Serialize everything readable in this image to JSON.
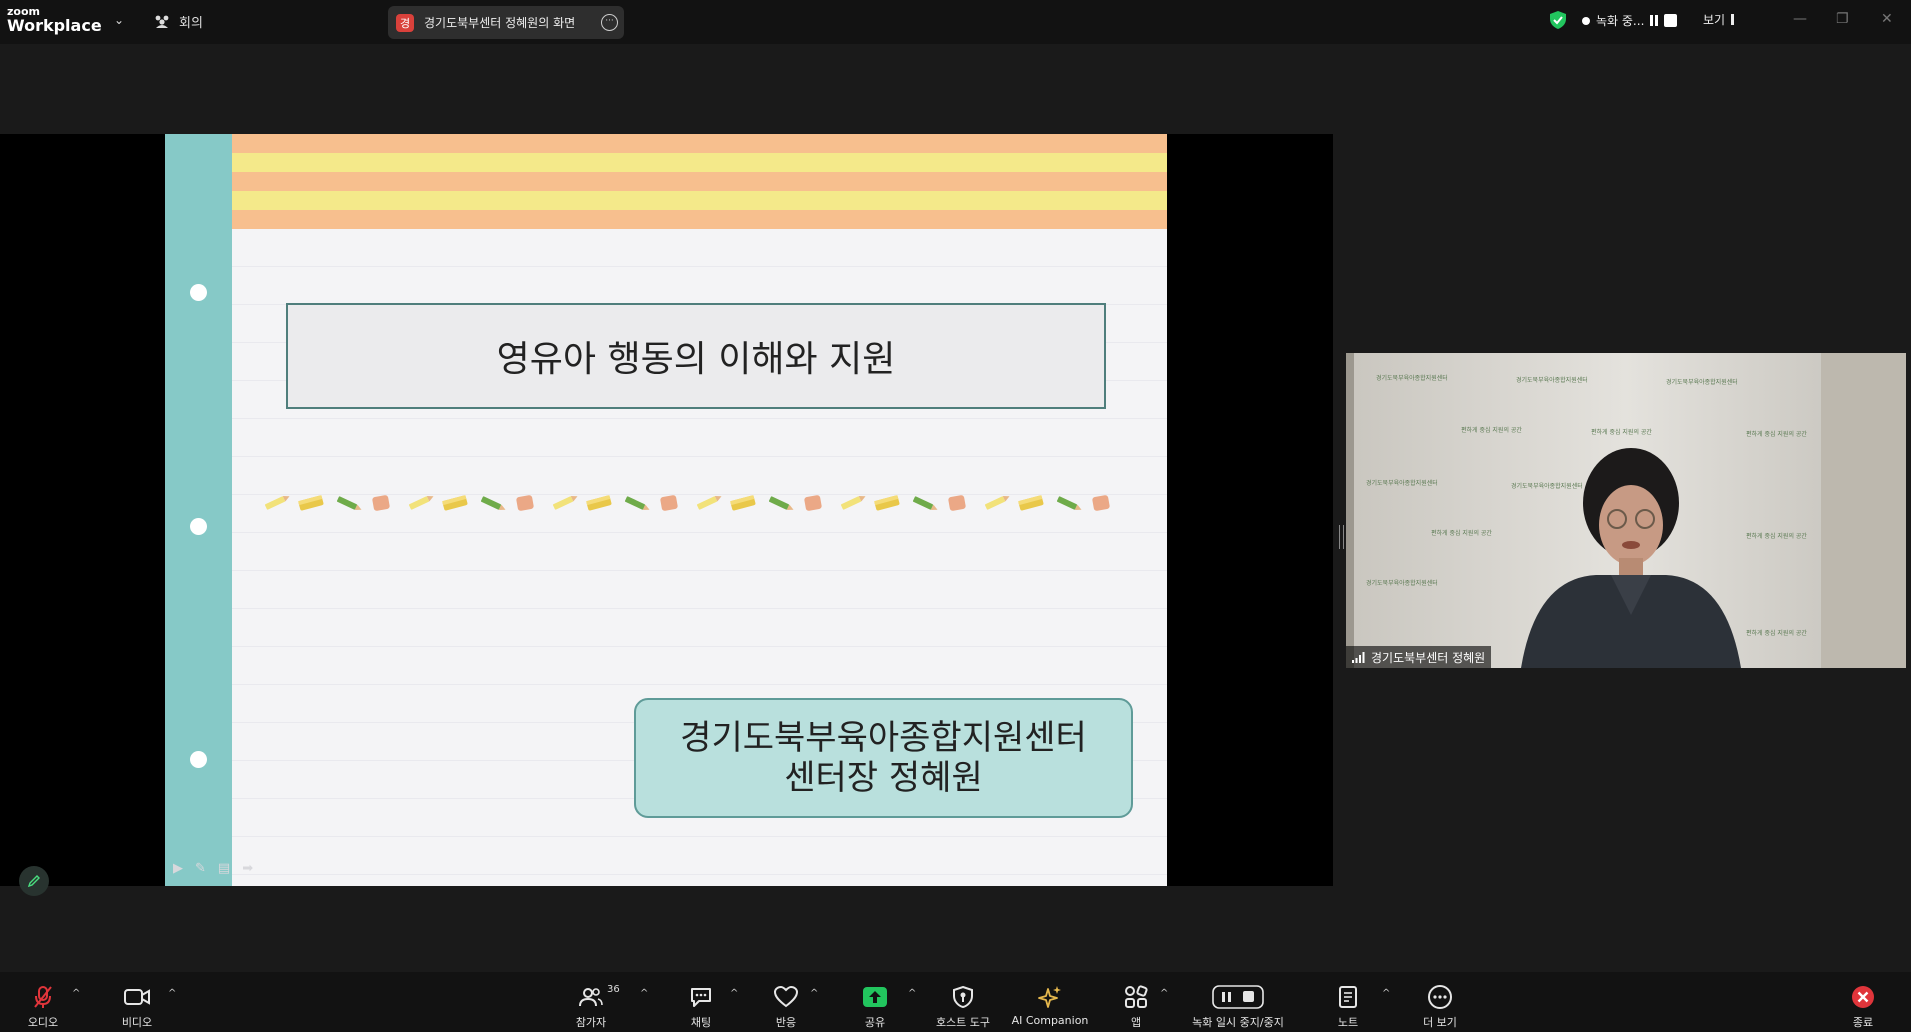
{
  "app": {
    "logo_line1": "zoom",
    "logo_line2": "Workplace"
  },
  "topbar": {
    "meeting_label": "회의",
    "share_badge": "경",
    "share_title": "경기도북부센터 정혜원의 화면",
    "recording_label": "녹화 중...",
    "view_label": "보기"
  },
  "slide": {
    "title": "영유아 행동의 이해와 지원",
    "org_line": "경기도북부육아종합지원센터",
    "presenter_line": "센터장 정혜원",
    "stripe_colors": [
      "#f7bf8e",
      "#f4e98a"
    ],
    "spine_color": "#86c9c7"
  },
  "video": {
    "participant_name": "경기도북부센터 정혜원",
    "backdrop_text": "경기도북부육아종합지원센터",
    "backdrop_badge": "편하게 중심 지원의 공간"
  },
  "toolbar": {
    "audio": "오디오",
    "video": "비디오",
    "participants": "참가자",
    "participants_count": "36",
    "chat": "채팅",
    "reactions": "반응",
    "share": "공유",
    "host_tools": "호스트 도구",
    "ai_companion": "AI Companion",
    "apps": "앱",
    "recording_control": "녹화 일시 중지/중지",
    "notes": "노트",
    "more": "더 보기",
    "end": "종료"
  },
  "colors": {
    "share_green": "#22c55e",
    "end_red": "#e0353b",
    "ai_gold": "#e6b84d"
  }
}
